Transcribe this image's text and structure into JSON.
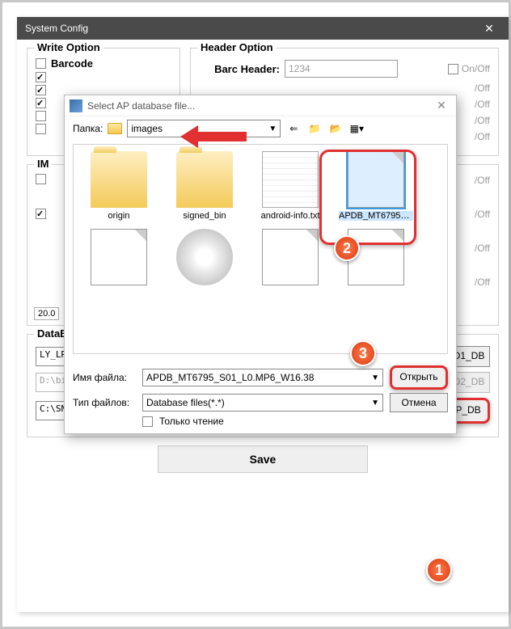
{
  "main_window": {
    "title": "System Config",
    "write_option": {
      "legend": "Write Option",
      "barcode_label": "Barcode",
      "imei_legend_prefix": "IM"
    },
    "header_option": {
      "legend": "Header Option",
      "barc_header_label": "Barc Header:",
      "barc_header_value": "1234",
      "onoff_label": "On/Off",
      "hidden_onoff": "/Off"
    },
    "database": {
      "legend": "DataBase File",
      "md1_path": "LY_LR9_W1423_MD_LWTG_LCSH6795_LWT_L_SP_V1_P1_1_ltg_n",
      "md1_btn": "MD1_DB",
      "md2_path": "D:\\bin\\95\\k95v2_1[dsda_op01]_ALPS.KK1.MP11.p59_eng\\BPLGUInfo",
      "md2_btn": "MD2_DB",
      "ap_path": "C:\\SN Writer\\Data\\APDB_MT6795_S01_L0.MP6_W15.41",
      "ap_btn": "AP_DB"
    },
    "save_label": "Save",
    "hidden_number": "20.0"
  },
  "file_dialog": {
    "title": "Select AP database file...",
    "folder_label": "Папка:",
    "folder_name": "images",
    "items": [
      {
        "name": "origin",
        "type": "folder"
      },
      {
        "name": "signed_bin",
        "type": "folder"
      },
      {
        "name": "android-info.txt",
        "type": "textfile"
      },
      {
        "name": "APDB_MT6795_S...",
        "type": "file",
        "selected": true
      },
      {
        "name": "",
        "type": "file"
      },
      {
        "name": "",
        "type": "disc"
      },
      {
        "name": "",
        "type": "file"
      },
      {
        "name": "",
        "type": "file"
      }
    ],
    "filename_label": "Имя файла:",
    "filename_value": "APDB_MT6795_S01_L0.MP6_W16.38",
    "filetype_label": "Тип файлов:",
    "filetype_value": "Database files(*.*)",
    "readonly_label": "Только чтение",
    "open_btn": "Открыть",
    "cancel_btn": "Отмена"
  },
  "badges": {
    "b1": "1",
    "b2": "2",
    "b3": "3"
  }
}
